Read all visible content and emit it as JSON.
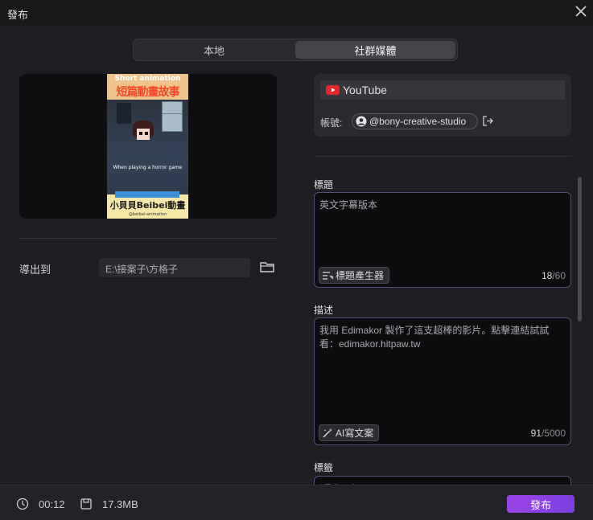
{
  "window": {
    "title": "發布"
  },
  "tabs": {
    "local": "本地",
    "social": "社群媒體",
    "active": "social"
  },
  "preview": {
    "line1": "Short animation",
    "line2": "短篇動畫故事",
    "caption": "When playing a horror game",
    "brand": "小貝貝Beibei動畫",
    "small": "@beibei-animation"
  },
  "export": {
    "label": "導出到",
    "path": "E:\\接案子\\方格子"
  },
  "platform": {
    "name": "YouTube",
    "account_label": "帳號:",
    "account": "@bony-creative-studio"
  },
  "title_field": {
    "label": "標題",
    "value": "英文字幕版本",
    "tool": "標題產生器",
    "count": "18",
    "max": "/60"
  },
  "desc_field": {
    "label": "描述",
    "value": "我用 Edimakor 製作了這支超棒的影片。點擊連結試試看：edimakor.hitpaw.tw",
    "tool": "AI寫文案",
    "count": "91",
    "max": "/5000"
  },
  "tags_field": {
    "label": "標籤",
    "value": "#Edimakor"
  },
  "footer": {
    "duration": "00:12",
    "size": "17.3MB",
    "publish": "發布"
  },
  "colors": {
    "accent": "#8b44e4",
    "bg": "#1e1e22",
    "field_border": "#5b4a7a"
  }
}
